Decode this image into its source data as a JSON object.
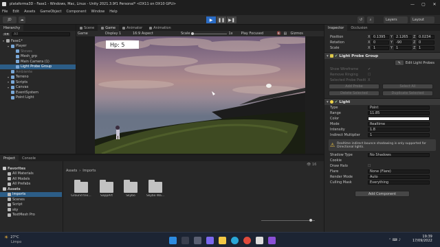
{
  "window": {
    "title": "plataforma3D - Fase1 - Windows, Mac, Linux - Unity 2021.3.9f1 Personal* <DX11 on DX10 GPU>",
    "minimize": "—",
    "maximize": "▢",
    "close": "✕"
  },
  "menu": [
    "File",
    "Edit",
    "Assets",
    "GameObject",
    "Component",
    "Window",
    "Help"
  ],
  "toolbar": {
    "account": "JD",
    "layers": "Layers",
    "layout": "Layout"
  },
  "hierarchy": {
    "tab": "Hierarchy",
    "search_placeholder": "All",
    "items": [
      {
        "label": "Fase1*",
        "indent": 0,
        "state": "scene"
      },
      {
        "label": "Player",
        "indent": 1,
        "state": "normal"
      },
      {
        "label": "Stoves",
        "indent": 2,
        "state": "disabled"
      },
      {
        "label": "Mesh_grp",
        "indent": 2,
        "state": "normal"
      },
      {
        "label": "Main Camera (1)",
        "indent": 2,
        "state": "normal"
      },
      {
        "label": "Light Probe Group",
        "indent": 2,
        "state": "selected"
      },
      {
        "label": "Ambiente",
        "indent": 1,
        "state": "disabled"
      },
      {
        "label": "Terreno",
        "indent": 1,
        "state": "normal"
      },
      {
        "label": "Scripts",
        "indent": 1,
        "state": "normal"
      },
      {
        "label": "Canvas",
        "indent": 1,
        "state": "normal"
      },
      {
        "label": "EventSystem",
        "indent": 1,
        "state": "normal"
      },
      {
        "label": "Point Light",
        "indent": 1,
        "state": "normal"
      }
    ]
  },
  "view_tabs": [
    "Scene",
    "Game",
    "Animator",
    "Animation"
  ],
  "game_bar": {
    "mode": "Game",
    "display": "Display 1",
    "aspect": "16:9 Aspect",
    "scale_label": "Scale",
    "scale_value": "1x",
    "play_focused": "Play Focused",
    "gizmos": "Gizmos"
  },
  "game_view": {
    "hp_label": "Hp: 5"
  },
  "project": {
    "tabs": [
      "Project",
      "Console"
    ],
    "breadcrumb": [
      "Assets",
      "Imports"
    ],
    "sidebar": [
      {
        "label": "Favorites",
        "indent": 0,
        "bold": true
      },
      {
        "label": "All Materials",
        "indent": 1,
        "bold": false
      },
      {
        "label": "All Models",
        "indent": 1,
        "bold": false
      },
      {
        "label": "All Prefabs",
        "indent": 1,
        "bold": false
      },
      {
        "label": "Assets",
        "indent": 0,
        "bold": true
      },
      {
        "label": "Imports",
        "indent": 1,
        "bold": false
      },
      {
        "label": "Scenes",
        "indent": 1,
        "bold": false
      },
      {
        "label": "Script",
        "indent": 1,
        "bold": false
      },
      {
        "label": "sky",
        "indent": 1,
        "bold": false
      },
      {
        "label": "TextMesh Pro",
        "indent": 1,
        "bold": false
      }
    ],
    "folders": [
      "Ground tex...",
      "SappArt",
      "Skybo",
      "Skybo Wa..."
    ],
    "count": "16"
  },
  "inspector": {
    "tabs": [
      "Inspector",
      "Occlusion"
    ],
    "transform": {
      "position": {
        "label": "Position",
        "x": "0.1395",
        "y": "2.1265",
        "z": "0.0234"
      },
      "rotation": {
        "label": "Rotation",
        "x": "0",
        "y": "-90",
        "z": "0"
      },
      "scale": {
        "label": "Scale",
        "x": "1",
        "y": "1",
        "z": "1"
      }
    },
    "light_probe_group": {
      "title": "Light Probe Group",
      "edit_button": "Edit Light Probes",
      "show_wireframe": "Show Wireframe",
      "remove_ringing": "Remove Ringing",
      "selected_pos": "Selected Probe Positi",
      "add_probe": "Add Probe",
      "select_all": "Select All",
      "delete_selected": "Delete Selected",
      "duplicate_selected": "Duplicate Selected"
    },
    "light": {
      "title": "Light",
      "rows": [
        {
          "label": "Type",
          "value": "Point"
        },
        {
          "label": "Range",
          "value": "11.85"
        },
        {
          "label": "Color",
          "value": ""
        },
        {
          "label": "Mode",
          "value": "Realtime"
        },
        {
          "label": "Intensity",
          "value": "1.8"
        },
        {
          "label": "Indirect Multiplier",
          "value": "1"
        }
      ],
      "warning": "Realtime indirect bounce shadowing is only supported for Directional lights.",
      "shadow_type_label": "Shadow Type",
      "shadow_type": "No Shadows",
      "cookie": "Cookie",
      "draw_halo": "Draw Halo",
      "flare_label": "Flare",
      "flare": "None (Flare)",
      "render_mode_label": "Render Mode",
      "render_mode": "Auto",
      "culling_mask_label": "Culling Mask",
      "culling_mask": "Everything"
    },
    "add_component": "Add Component"
  },
  "taskbar": {
    "weather_temp": "27°C",
    "weather_desc": "Limpo",
    "time": "19:39",
    "date": "17/09/2022"
  },
  "colors": {
    "accent": "#2b6cc4",
    "selection": "#2c5d87",
    "hp_box": "#ffffff"
  }
}
